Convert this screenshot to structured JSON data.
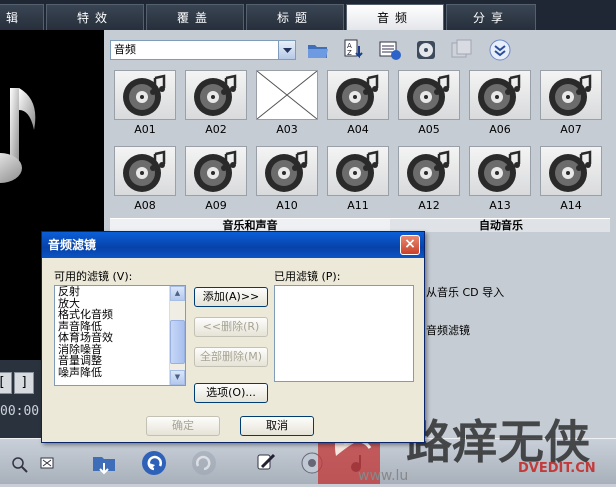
{
  "tabs": [
    {
      "label": "辑",
      "active": false
    },
    {
      "label": "特效",
      "active": false
    },
    {
      "label": "覆盖",
      "active": false
    },
    {
      "label": "标题",
      "active": false
    },
    {
      "label": "音频",
      "active": true
    },
    {
      "label": "分享",
      "active": false
    }
  ],
  "library": {
    "category": "音频",
    "clips": [
      {
        "label": "A01",
        "icon": "audio-disc-icon"
      },
      {
        "label": "A02",
        "icon": "audio-disc-icon"
      },
      {
        "label": "A03",
        "icon": "missing-thumbnail-icon"
      },
      {
        "label": "A04",
        "icon": "audio-disc-icon"
      },
      {
        "label": "A05",
        "icon": "audio-disc-icon"
      },
      {
        "label": "A06",
        "icon": "audio-disc-icon"
      },
      {
        "label": "A07",
        "icon": "audio-disc-icon"
      },
      {
        "label": "A08",
        "icon": "audio-disc-icon"
      },
      {
        "label": "A09",
        "icon": "audio-disc-icon"
      },
      {
        "label": "A10",
        "icon": "audio-disc-icon"
      },
      {
        "label": "A11",
        "icon": "audio-disc-icon"
      },
      {
        "label": "A12",
        "icon": "audio-disc-icon"
      },
      {
        "label": "A13",
        "icon": "audio-disc-icon"
      },
      {
        "label": "A14",
        "icon": "audio-disc-icon"
      }
    ],
    "options_tabs": [
      "音乐和声音",
      "自动音乐"
    ],
    "option_rows": [
      "从音乐 CD 导入",
      "音频滤镜"
    ]
  },
  "preview": {
    "timecode": "00:00",
    "bracket_left": "[",
    "bracket_right": "]"
  },
  "dialog": {
    "title": "音频滤镜",
    "available_label": "可用的滤镜 (V):",
    "used_label": "已用滤镜 (P):",
    "available_filters": [
      "反射",
      "放大",
      "格式化音频",
      "声音降低",
      "体育场音效",
      "消除噪音",
      "音量调整",
      "噪声降低"
    ],
    "add_button": "添加(A)>>",
    "remove_button": "<<删除(R)",
    "remove_all_button": "全部删除(M)",
    "options_button": "选项(O)...",
    "ok_button": "确定",
    "cancel_button": "取消"
  },
  "watermark": {
    "site": "DVEDIT.CN",
    "url_fragment": "www.lu"
  },
  "colors": {
    "dialog_title": "#0a53c8",
    "dark_bg": "#1e2733",
    "panel": "#c6ccd4"
  }
}
